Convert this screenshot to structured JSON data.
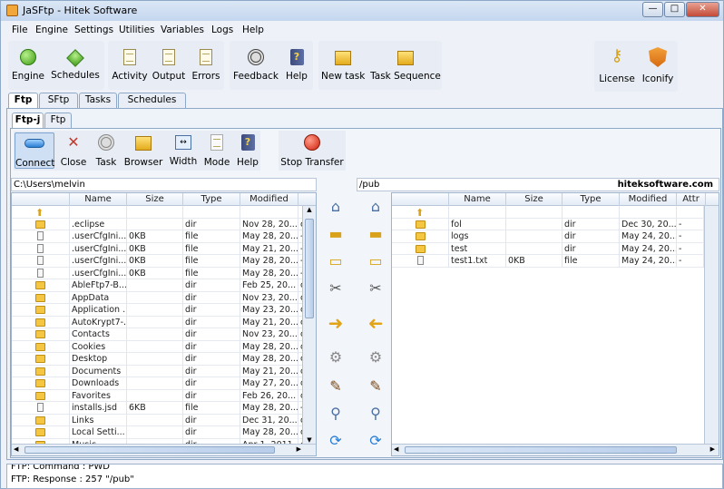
{
  "window": {
    "title": "JaSFtp  -  Hitek Software",
    "min_label": "—",
    "max_label": "□",
    "close_label": "✕"
  },
  "menu": [
    "File",
    "Engine",
    "Settings",
    "Utilities",
    "Variables",
    "Logs",
    "Help"
  ],
  "toolbar": {
    "engine": "Engine",
    "schedules": "Schedules",
    "activity": "Activity",
    "output": "Output",
    "errors": "Errors",
    "feedback": "Feedback",
    "help": "Help",
    "new_task": "New task",
    "task_sequence": "Task Sequence",
    "license": "License",
    "iconify": "Iconify"
  },
  "tabs": [
    "Ftp",
    "SFtp",
    "Tasks",
    "Schedules"
  ],
  "subtabs": [
    "Ftp-j",
    "Ftp"
  ],
  "subtoolbar": {
    "connect": "Connect",
    "close": "Close",
    "task": "Task",
    "browser": "Browser",
    "width": "Width",
    "mode": "Mode",
    "help": "Help",
    "stop_transfer": "Stop Transfer"
  },
  "local": {
    "path": "C:\\Users\\melvin",
    "columns": [
      "Name",
      "Size",
      "Type",
      "Modified"
    ],
    "rows": [
      {
        "icon": "up",
        "name": "",
        "size": "",
        "type": "",
        "modified": "",
        "attr": ""
      },
      {
        "icon": "folder",
        "name": ".eclipse",
        "size": "",
        "type": "dir",
        "modified": "Nov 28, 20...",
        "attr": "c"
      },
      {
        "icon": "file",
        "name": ".userCfgIni...",
        "size": "0KB",
        "type": "file",
        "modified": "May 28, 20...",
        "attr": "-"
      },
      {
        "icon": "file",
        "name": ".userCfgIni...",
        "size": "0KB",
        "type": "file",
        "modified": "May 21, 20...",
        "attr": "-"
      },
      {
        "icon": "file",
        "name": ".userCfgIni...",
        "size": "0KB",
        "type": "file",
        "modified": "May 28, 20...",
        "attr": "-"
      },
      {
        "icon": "file",
        "name": ".userCfgIni...",
        "size": "0KB",
        "type": "file",
        "modified": "May 28, 20...",
        "attr": "-"
      },
      {
        "icon": "folder",
        "name": "AbleFtp7-B...",
        "size": "",
        "type": "dir",
        "modified": "Feb 25, 20...",
        "attr": "c"
      },
      {
        "icon": "folder",
        "name": "AppData",
        "size": "",
        "type": "dir",
        "modified": "Nov 23, 20...",
        "attr": "c"
      },
      {
        "icon": "folder",
        "name": "Application ...",
        "size": "",
        "type": "dir",
        "modified": "May 23, 20...",
        "attr": "c"
      },
      {
        "icon": "folder",
        "name": "AutoKrypt7-...",
        "size": "",
        "type": "dir",
        "modified": "May 21, 20...",
        "attr": "c"
      },
      {
        "icon": "folder",
        "name": "Contacts",
        "size": "",
        "type": "dir",
        "modified": "Nov 23, 20...",
        "attr": "c"
      },
      {
        "icon": "folder",
        "name": "Cookies",
        "size": "",
        "type": "dir",
        "modified": "May 28, 20...",
        "attr": "c"
      },
      {
        "icon": "folder",
        "name": "Desktop",
        "size": "",
        "type": "dir",
        "modified": "May 28, 20...",
        "attr": "c"
      },
      {
        "icon": "folder",
        "name": "Documents",
        "size": "",
        "type": "dir",
        "modified": "May 21, 20...",
        "attr": "c"
      },
      {
        "icon": "folder",
        "name": "Downloads",
        "size": "",
        "type": "dir",
        "modified": "May 27, 20...",
        "attr": "c"
      },
      {
        "icon": "folder",
        "name": "Favorites",
        "size": "",
        "type": "dir",
        "modified": "Feb 26, 20...",
        "attr": "c"
      },
      {
        "icon": "file",
        "name": "installs.jsd",
        "size": "6KB",
        "type": "file",
        "modified": "May 28, 20...",
        "attr": "-"
      },
      {
        "icon": "folder",
        "name": "Links",
        "size": "",
        "type": "dir",
        "modified": "Dec 31, 20...",
        "attr": "c"
      },
      {
        "icon": "folder",
        "name": "Local Setti...",
        "size": "",
        "type": "dir",
        "modified": "May 28, 20...",
        "attr": "c"
      },
      {
        "icon": "folder",
        "name": "Music",
        "size": "",
        "type": "dir",
        "modified": "Apr 1, 2011",
        "attr": "c"
      }
    ]
  },
  "remote": {
    "path": "/pub",
    "host": "hiteksoftware.com",
    "columns": [
      "Name",
      "Size",
      "Type",
      "Modified",
      "Attr"
    ],
    "rows": [
      {
        "icon": "up",
        "name": "",
        "size": "",
        "type": "",
        "modified": "",
        "attr": ""
      },
      {
        "icon": "folder",
        "name": "fol",
        "size": "",
        "type": "dir",
        "modified": "Dec 30, 20...",
        "attr": "-"
      },
      {
        "icon": "folder",
        "name": "logs",
        "size": "",
        "type": "dir",
        "modified": "May 24, 20...",
        "attr": "-"
      },
      {
        "icon": "folder",
        "name": "test",
        "size": "",
        "type": "dir",
        "modified": "May 24, 20...",
        "attr": "-"
      },
      {
        "icon": "file",
        "name": "test1.txt",
        "size": "0KB",
        "type": "file",
        "modified": "May 24, 20...",
        "attr": "-"
      }
    ]
  },
  "log": [
    "FTP: Command : PWD",
    "FTP: Response : 257 \"/pub\""
  ]
}
